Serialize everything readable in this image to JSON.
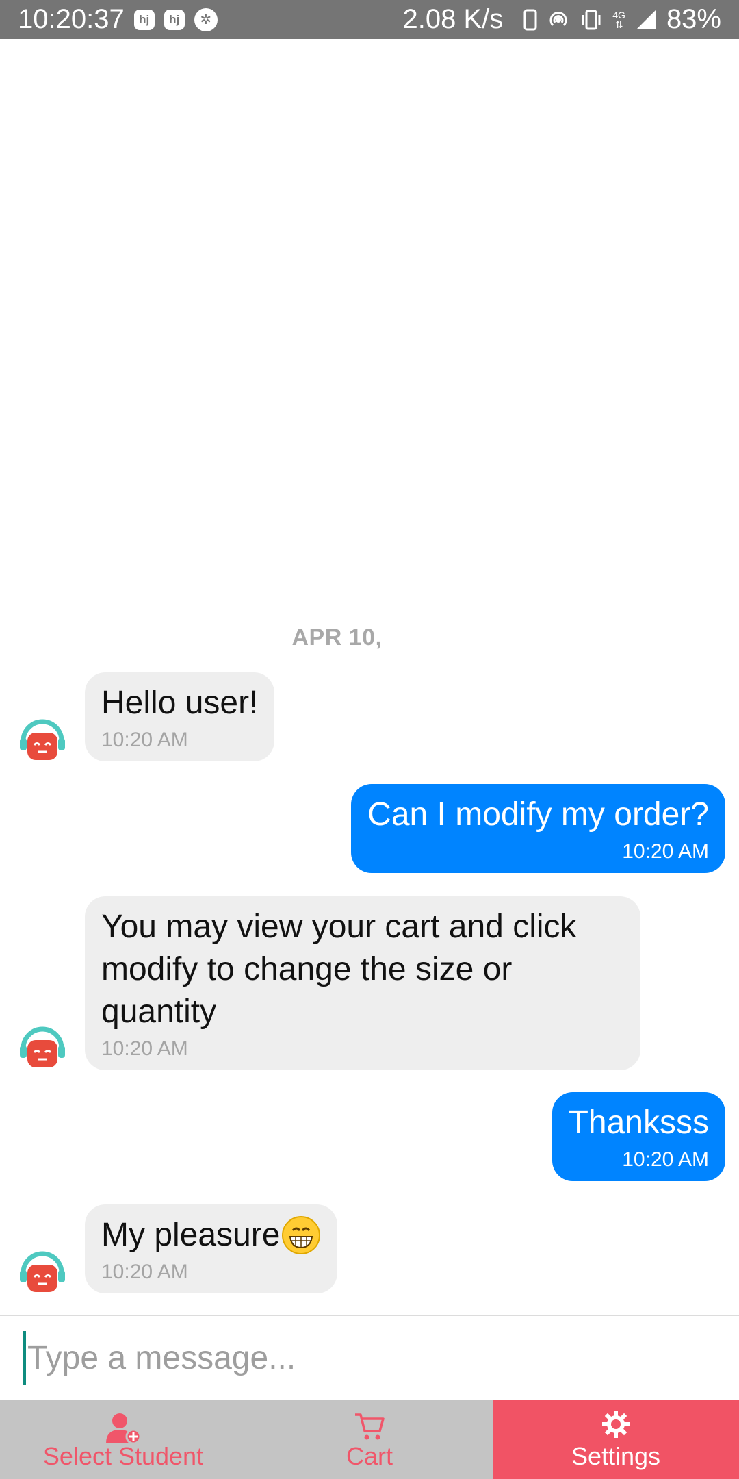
{
  "status_bar": {
    "time": "10:20:37",
    "net_speed": "2.08 K/s",
    "network_type": "4G",
    "battery": "83%",
    "icons": [
      "hj-app-icon",
      "hj-app-icon",
      "aperture-icon",
      "phone-icon",
      "hotspot-icon",
      "vibrate-icon",
      "data-arrows-icon",
      "signal-icon"
    ]
  },
  "chat": {
    "date_label": "APR 10,",
    "messages": [
      {
        "direction": "in",
        "text": "Hello user!",
        "time": "10:20 AM"
      },
      {
        "direction": "out",
        "text": "Can I modify my order?",
        "time": "10:20 AM"
      },
      {
        "direction": "in",
        "text": "You may view your cart and click modify to change the size or quantity",
        "time": "10:20 AM"
      },
      {
        "direction": "out",
        "text": "Thanksss",
        "time": "10:20 AM"
      },
      {
        "direction": "in",
        "text": "My pleasure",
        "emoji": "grinning-face-icon",
        "time": "10:20 AM"
      }
    ]
  },
  "input": {
    "placeholder": "Type a message...",
    "value": ""
  },
  "bottom_nav": {
    "items": [
      {
        "label": "Select Student",
        "icon": "add-user-icon",
        "active": false
      },
      {
        "label": "Cart",
        "icon": "cart-icon",
        "active": false
      },
      {
        "label": "Settings",
        "icon": "gear-icon",
        "active": true
      }
    ]
  },
  "colors": {
    "status_bar": "#757575",
    "incoming_bubble": "#eeeeee",
    "outgoing_bubble": "#0084ff",
    "nav_background": "#c4c4c4",
    "nav_active": "#f15365",
    "nav_inactive_text": "#f0566a",
    "avatar_headset": "#4ec9c0",
    "avatar_face": "#e84b3c"
  }
}
